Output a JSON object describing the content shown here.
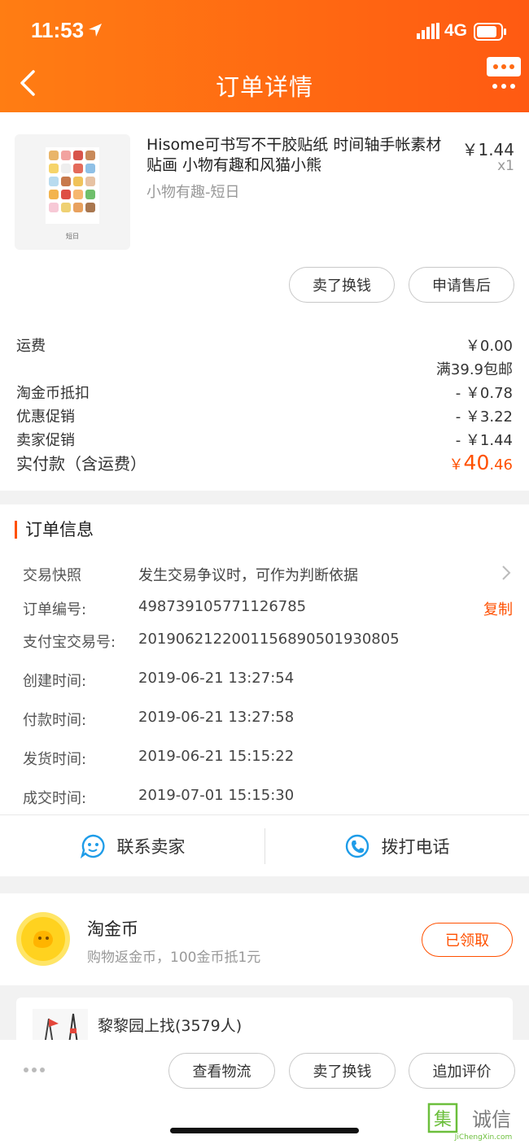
{
  "status_bar": {
    "time": "11:53",
    "network": "4G"
  },
  "header": {
    "title": "订单详情"
  },
  "product": {
    "title": "Hisome可书写不干胶贴纸 时间轴手帐素材贴画 小物有趣和风猫小熊",
    "sku": "小物有趣-短日",
    "price": "￥1.44",
    "quantity": "x1",
    "thumb_caption": "短日",
    "actions": {
      "sell": "卖了换钱",
      "after_sale": "申请售后"
    }
  },
  "fees": [
    {
      "label": "运费",
      "value": "￥0.00"
    },
    {
      "label": "",
      "value": "满39.9包邮"
    },
    {
      "label": "淘金币抵扣",
      "value": "- ￥0.78"
    },
    {
      "label": "优惠促销",
      "value": "- ￥3.22"
    },
    {
      "label": "卖家促销",
      "value": "- ￥1.44"
    }
  ],
  "paid": {
    "label": "实付款（含运费）",
    "currency": "￥",
    "integer": "40",
    "decimal": ".46"
  },
  "order_info": {
    "title": "订单信息",
    "snapshot_label": "交易快照",
    "snapshot_value": "发生交易争议时，可作为判断依据",
    "order_no_label": "订单编号:",
    "order_no": "498739105771126785",
    "copy_label": "复制",
    "alipay_label": "支付宝交易号:",
    "alipay_no": "2019062122001156890501930805",
    "created_label": "创建时间:",
    "created": "2019-06-21 13:27:54",
    "paid_label": "付款时间:",
    "paid": "2019-06-21 13:27:58",
    "shipped_label": "发货时间:",
    "shipped": "2019-06-21 15:15:22",
    "closed_label": "成交时间:",
    "closed": "2019-07-01 15:15:30"
  },
  "contact": {
    "seller": "联系卖家",
    "phone": "拨打电话"
  },
  "coin": {
    "title": "淘金币",
    "subtitle": "购物返金币，100金币抵1元",
    "button": "已领取"
  },
  "group": {
    "name": "黎黎园上找(3579人)"
  },
  "bottom_actions": {
    "logistics": "查看物流",
    "sell": "卖了换钱",
    "review": "追加评价"
  },
  "watermark": {
    "brand": "集诚信",
    "url": "JiChengXin.com"
  },
  "colors": {
    "accent": "#ff5000",
    "header_start": "#ff7d13",
    "header_end": "#ff5a12"
  },
  "icons": [
    "location-arrow-icon",
    "signal-icon",
    "battery-icon",
    "back-arrow-icon",
    "chat-bubble-icon",
    "chevron-right-icon",
    "seller-face-icon",
    "phone-icon",
    "gold-coin-icon",
    "more-dots-icon"
  ]
}
